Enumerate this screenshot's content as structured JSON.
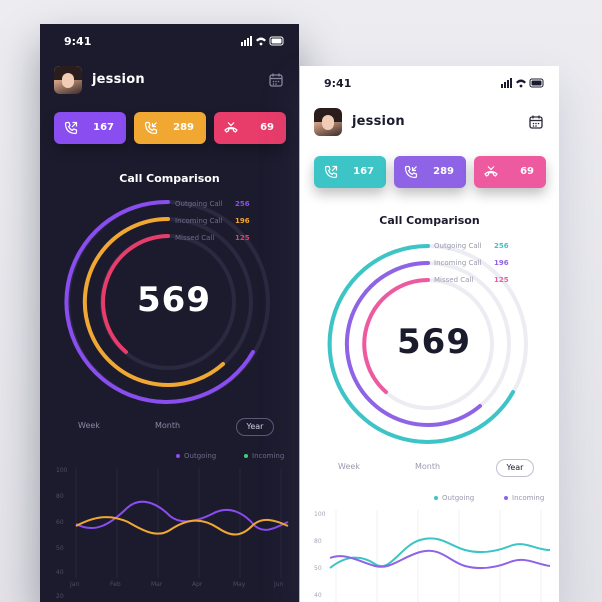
{
  "dark_screen": {
    "status_time": "9:41",
    "user_name": "jession",
    "call_buttons": [
      {
        "kind": "outgoing",
        "value": "167",
        "color": "#8a4df0"
      },
      {
        "kind": "incoming",
        "value": "289",
        "color": "#f0a832"
      },
      {
        "kind": "missed",
        "value": "69",
        "color": "#e83c6a"
      }
    ],
    "section_title": "Call Comparison",
    "total": "569",
    "legend": [
      {
        "label": "Outgoing Call",
        "value": "256",
        "color": "#8a4df0"
      },
      {
        "label": "Incoming Call",
        "value": "196",
        "color": "#f0a832"
      },
      {
        "label": "Missed Call",
        "value": "125",
        "color": "#e83c6a"
      }
    ],
    "periods": [
      "Week",
      "Month",
      "Year"
    ],
    "selected_period": "Year",
    "chart_legend": [
      {
        "label": "Outgoing",
        "color": "#8a4df0"
      },
      {
        "label": "Incoming",
        "color": "#3fd07a"
      }
    ],
    "chart_y_ticks": [
      "100",
      "80",
      "60",
      "50",
      "40",
      "20"
    ],
    "chart_x_ticks": [
      "Jan",
      "Feb",
      "Mar",
      "Apr",
      "May",
      "Jun"
    ]
  },
  "light_screen": {
    "status_time": "9:41",
    "user_name": "jession",
    "call_buttons": [
      {
        "kind": "outgoing",
        "value": "167",
        "color": "#3cc4c6"
      },
      {
        "kind": "incoming",
        "value": "289",
        "color": "#8e63e6"
      },
      {
        "kind": "missed",
        "value": "69",
        "color": "#ee5aa0"
      }
    ],
    "section_title": "Call Comparison",
    "total": "569",
    "legend": [
      {
        "label": "Outgoing Call",
        "value": "256",
        "color": "#3cc4c6"
      },
      {
        "label": "Incoming Call",
        "value": "196",
        "color": "#8e63e6"
      },
      {
        "label": "Missed Call",
        "value": "125",
        "color": "#ee5aa0"
      }
    ],
    "periods": [
      "Week",
      "Month",
      "Year"
    ],
    "selected_period": "Year",
    "chart_legend": [
      {
        "label": "Outgoing",
        "color": "#3cc4c6"
      },
      {
        "label": "Incoming",
        "color": "#8e63e6"
      }
    ],
    "chart_y_ticks": [
      "100",
      "80",
      "50",
      "40"
    ]
  }
}
